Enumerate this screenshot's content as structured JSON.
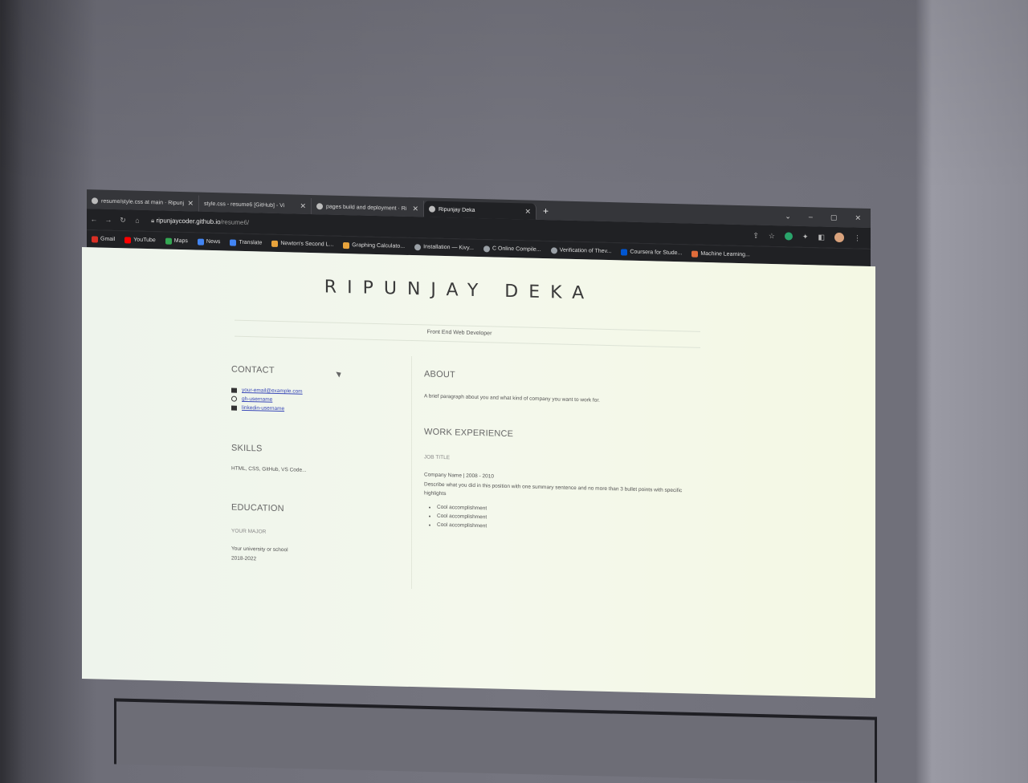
{
  "tabs": [
    {
      "title": "resume/style.css at main · Ripunj",
      "active": false
    },
    {
      "title": "style.css - resume6 [GitHub] - Vi",
      "active": false
    },
    {
      "title": "pages build and deployment · Ri",
      "active": false
    },
    {
      "title": "Ripunjay Deka",
      "active": true
    }
  ],
  "address": {
    "domain": "ripunjaycoder.github.io",
    "path": "/resume6/"
  },
  "bookmarks": [
    {
      "label": "Gmail",
      "color": "#d93025"
    },
    {
      "label": "YouTube",
      "color": "#ff0000"
    },
    {
      "label": "Maps",
      "color": "#34a853"
    },
    {
      "label": "News",
      "color": "#4285f4"
    },
    {
      "label": "Translate",
      "color": "#4285f4"
    },
    {
      "label": "Newton's Second L...",
      "color": "#e8a33c"
    },
    {
      "label": "Graphing Calculato...",
      "color": "#e8a33c"
    },
    {
      "label": "Installation — Kivy...",
      "color": "#9aa0a6"
    },
    {
      "label": "C Online Compile...",
      "color": "#9aa0a6"
    },
    {
      "label": "Verification of Thev...",
      "color": "#9aa0a6"
    },
    {
      "label": "Coursera for Stude...",
      "color": "#0056d2"
    },
    {
      "label": "Machine Learning...",
      "color": "#e06c3a"
    }
  ],
  "resume": {
    "name": "RIPUNJAY DEKA",
    "subtitle": "Front End Web Developer",
    "contact": {
      "heading": "CONTACT",
      "email": "your-email@example.com",
      "github": "gh-username",
      "linkedin": "linkedin-username"
    },
    "skills": {
      "heading": "SKILLS",
      "text": "HTML, CSS, GitHub, VS Code..."
    },
    "education": {
      "heading": "EDUCATION",
      "major": "YOUR MAJOR",
      "school": "Your university or school",
      "years": "2018-2022"
    },
    "about": {
      "heading": "ABOUT",
      "text": "A brief paragraph about you and what kind of company you want to work for."
    },
    "work": {
      "heading": "WORK EXPERIENCE",
      "job_title": "JOB TITLE",
      "company": "Company Name | 2008 - 2010",
      "description": "Describe what you did in this position with one summary sentence and no more than 3 bullet points with specific highlights",
      "bullets": [
        "Cool accomplishment",
        "Cool accomplishment",
        "Cool accomplishment"
      ]
    }
  }
}
